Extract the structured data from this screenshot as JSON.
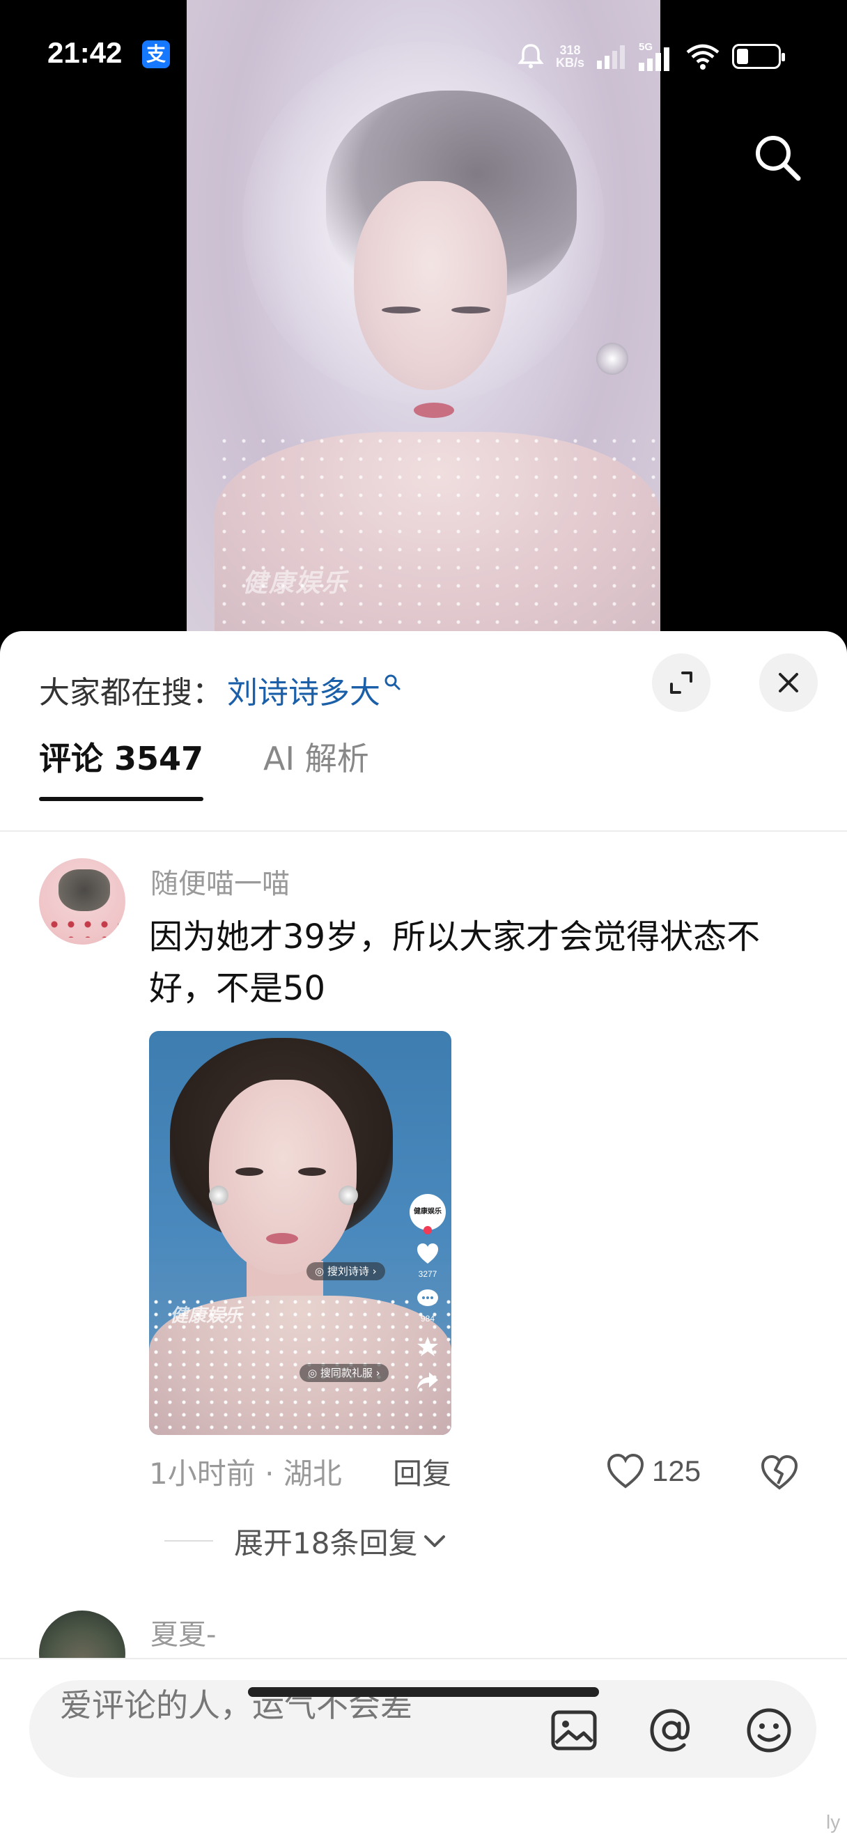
{
  "status_bar": {
    "time": "21:42",
    "app_badge": "支",
    "net_speed": "318\nKB/s",
    "network": "5G"
  },
  "video": {
    "watermark": "健康娱乐"
  },
  "hot_search": {
    "prefix": "大家都在搜：",
    "term": "刘诗诗多大"
  },
  "tabs": [
    {
      "label": "评论 3547",
      "active": true
    },
    {
      "label": "AI 解析",
      "active": false
    }
  ],
  "comments": [
    {
      "username": "随便喵一喵",
      "text": "因为她才39岁，所以大家才会觉得状态不好，不是50",
      "image": {
        "watermark": "健康娱乐",
        "pill_1": "◎ 搜刘诗诗 ›",
        "pill_2": "◎ 搜同款礼服 ›",
        "side_logo": "健康娱乐",
        "like_count": "3277",
        "comment_count": "984"
      },
      "time_location": "1小时前 · 湖北",
      "reply_label": "回复",
      "likes": "125",
      "expand_label": "展开18条回复"
    },
    {
      "username": "夏夏-"
    }
  ],
  "input": {
    "placeholder": "爱评论的人，运气不会差"
  },
  "corner_mark": "ly",
  "colors": {
    "accent_link": "#1a5fa8",
    "text_primary": "#111111",
    "text_secondary": "#999999"
  }
}
